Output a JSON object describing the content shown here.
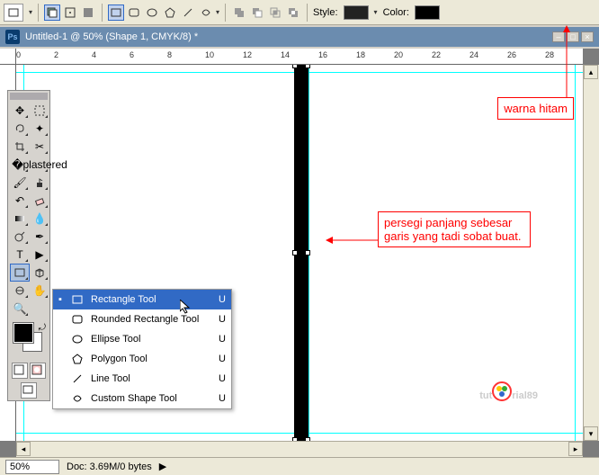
{
  "options_bar": {
    "style_label": "Style:",
    "color_label": "Color:",
    "style_value": "#222222",
    "color_value": "#000000"
  },
  "document": {
    "tab_title": "Untitled-1 @ 50% (Shape 1, CMYK/8) *"
  },
  "ruler_top": [
    "0",
    "2",
    "4",
    "6",
    "8",
    "10",
    "12",
    "14",
    "16",
    "18",
    "20",
    "22",
    "24",
    "26",
    "28"
  ],
  "shape_menu": {
    "items": [
      {
        "label": "Rectangle Tool",
        "key": "U",
        "selected": true
      },
      {
        "label": "Rounded Rectangle Tool",
        "key": "U",
        "selected": false
      },
      {
        "label": "Ellipse Tool",
        "key": "U",
        "selected": false
      },
      {
        "label": "Polygon Tool",
        "key": "U",
        "selected": false
      },
      {
        "label": "Line Tool",
        "key": "U",
        "selected": false
      },
      {
        "label": "Custom Shape Tool",
        "key": "U",
        "selected": false
      }
    ],
    "bullet": "▪"
  },
  "annotations": {
    "color": "warna hitam",
    "rect": "persegi panjang sebesar garis yang tadi sobat buat."
  },
  "status": {
    "zoom": "50%",
    "doc_info": "Doc: 3.69M/0 bytes",
    "arrow": "▶"
  },
  "watermark": {
    "t1": "tut",
    "t2": "rial",
    "t3": "89"
  }
}
